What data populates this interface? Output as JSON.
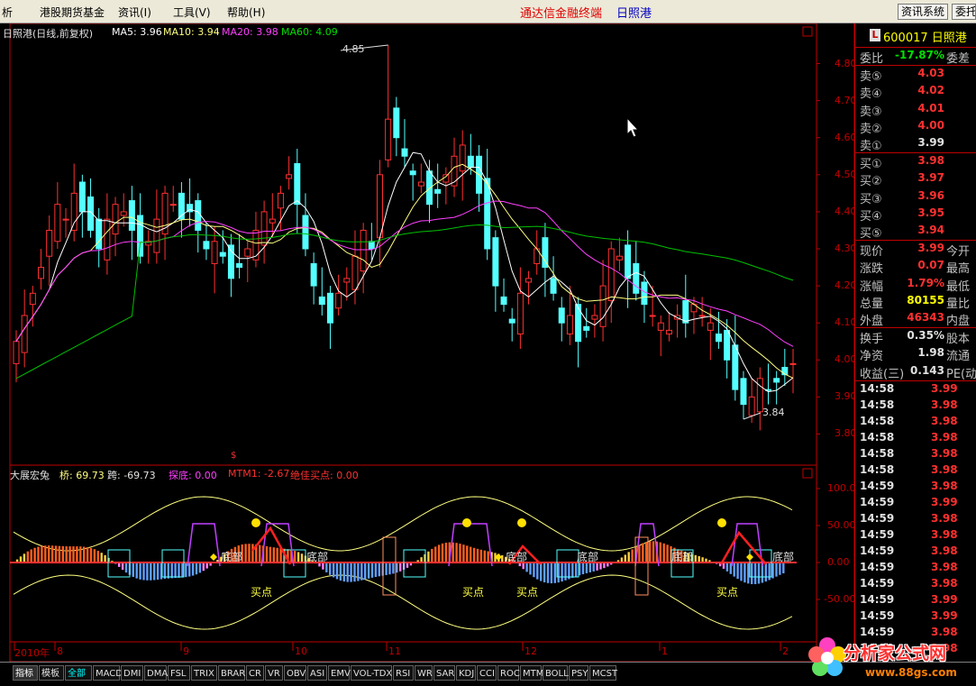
{
  "menu": {
    "items": [
      "析",
      "港股期货基金",
      "资讯(I)",
      "工具(V)",
      "帮助(H)"
    ],
    "app_title": "通达信金融终端",
    "stock_name": "日照港",
    "btn_news": "资讯系统",
    "btn_other": "委托"
  },
  "chart_header": {
    "title": "日照港(日线,前复权)",
    "ma5": "MA5: 3.96",
    "ma10": "MA10: 3.94",
    "ma20": "MA20: 3.98",
    "ma60": "MA60: 4.09",
    "high_mark": "4.85",
    "low_mark": "3.84",
    "dollar": "$"
  },
  "indicator_header": {
    "name": "大展宏兔",
    "qiao": "桥: 69.73",
    "kua": "跨: -69.73",
    "tandi": "探底: 0.00",
    "mtm": "MTM1: -2.67",
    "best": "绝佳买点: 0.00"
  },
  "price_axis": [
    "4.80",
    "4.70",
    "4.60",
    "4.50",
    "4.40",
    "4.30",
    "4.20",
    "4.10",
    "4.00",
    "3.90",
    "3.80"
  ],
  "ind_axis": [
    "100.0",
    "50.00",
    "0.00",
    "-50.00"
  ],
  "date_axis": [
    "2010年",
    "8",
    "9",
    "10",
    "11",
    "12",
    "1",
    "2"
  ],
  "annotations": {
    "bottom": "底部",
    "buy": "买点"
  },
  "quote": {
    "code": "600017",
    "name": "日照港",
    "badge": "L",
    "weibi_label": "委比",
    "weibi_value": "-17.87%",
    "weibi_extra": "委差",
    "sells": [
      {
        "label": "卖⑤",
        "price": "4.03"
      },
      {
        "label": "卖④",
        "price": "4.02"
      },
      {
        "label": "卖③",
        "price": "4.01"
      },
      {
        "label": "卖②",
        "price": "4.00"
      },
      {
        "label": "卖①",
        "price": "3.99"
      }
    ],
    "buys": [
      {
        "label": "买①",
        "price": "3.98"
      },
      {
        "label": "买②",
        "price": "3.97"
      },
      {
        "label": "买③",
        "price": "3.96"
      },
      {
        "label": "买④",
        "price": "3.95"
      },
      {
        "label": "买⑤",
        "price": "3.94"
      }
    ],
    "stats": [
      {
        "label": "现价",
        "value": "3.99",
        "extra": "今开",
        "color": "#ff3030"
      },
      {
        "label": "涨跌",
        "value": "0.07",
        "extra": "最高",
        "color": "#ff3030"
      },
      {
        "label": "涨幅",
        "value": "1.79%",
        "extra": "最低",
        "color": "#ff3030"
      },
      {
        "label": "总量",
        "value": "80155",
        "extra": "量比",
        "color": "#ffff00"
      },
      {
        "label": "外盘",
        "value": "46343",
        "extra": "内盘",
        "color": "#ff3030"
      }
    ],
    "stats2": [
      {
        "label": "换手",
        "value": "0.35%",
        "extra": "股本",
        "color": "#e0e0e0"
      },
      {
        "label": "净资",
        "value": "1.98",
        "extra": "流通",
        "color": "#e0e0e0"
      },
      {
        "label": "收益(三)",
        "value": "0.143",
        "extra": "PE(动",
        "color": "#e0e0e0"
      }
    ],
    "ticks": [
      {
        "time": "14:58",
        "price": "3.99"
      },
      {
        "time": "14:58",
        "price": "3.98"
      },
      {
        "time": "14:58",
        "price": "3.98"
      },
      {
        "time": "14:58",
        "price": "3.98"
      },
      {
        "time": "14:58",
        "price": "3.98"
      },
      {
        "time": "14:58",
        "price": "3.98"
      },
      {
        "time": "14:59",
        "price": "3.98"
      },
      {
        "time": "14:59",
        "price": "3.99"
      },
      {
        "time": "14:59",
        "price": "3.98"
      },
      {
        "time": "14:59",
        "price": "3.98"
      },
      {
        "time": "14:59",
        "price": "3.98"
      },
      {
        "time": "14:59",
        "price": "3.98"
      },
      {
        "time": "14:59",
        "price": "3.98"
      },
      {
        "time": "14:59",
        "price": "3.99"
      },
      {
        "time": "14:59",
        "price": "3.99"
      },
      {
        "time": "14:59",
        "price": "3.98"
      },
      {
        "time": "14:59",
        "price": "3.98"
      }
    ]
  },
  "tabs": [
    "指标",
    "模板",
    "全部",
    "MACD",
    "DMI",
    "DMA",
    "FSL",
    "TRIX",
    "BRAR",
    "CR",
    "VR",
    "OBV",
    "ASI",
    "EMV",
    "VOL-TDX",
    "RSI",
    "WR",
    "SAR",
    "KDJ",
    "CCI",
    "ROC",
    "MTM",
    "BOLL",
    "PSY",
    "MCST"
  ],
  "logo": {
    "line1": "分析家公式网",
    "line2": "www.88gs.com"
  },
  "colors": {
    "up": "#ff3030",
    "down": "#54ffff",
    "ma5": "#ffffff",
    "ma10": "#ffff80",
    "ma20": "#ff40ff",
    "ma60": "#00c000",
    "axis": "#c00000"
  },
  "chart_data": {
    "type": "candlestick",
    "title": "日照港(日线,前复权)",
    "ylim": [
      3.75,
      4.85
    ],
    "high": 4.85,
    "low": 3.84,
    "closes": [
      4.05,
      4.12,
      4.18,
      4.25,
      4.35,
      4.42,
      4.38,
      4.45,
      4.4,
      4.35,
      4.3,
      4.38,
      4.42,
      4.4,
      4.35,
      4.28,
      4.32,
      4.38,
      4.45,
      4.42,
      4.38,
      4.4,
      4.35,
      4.3,
      4.32,
      4.28,
      4.22,
      4.25,
      4.3,
      4.35,
      4.4,
      4.38,
      4.45,
      4.5,
      4.42,
      4.3,
      4.2,
      4.15,
      4.1,
      4.18,
      4.22,
      4.28,
      4.35,
      4.3,
      4.5,
      4.65,
      4.6,
      4.55,
      4.5,
      4.48,
      4.42,
      4.45,
      4.5,
      4.55,
      4.58,
      4.52,
      4.45,
      4.3,
      4.2,
      4.15,
      4.1,
      4.18,
      4.22,
      4.3,
      4.25,
      4.18,
      4.1,
      4.12,
      4.05,
      4.08,
      4.12,
      4.2,
      4.3,
      4.28,
      4.22,
      4.18,
      4.15,
      4.12,
      4.1,
      4.08,
      4.12,
      4.1,
      4.15,
      4.12,
      4.1,
      4.05,
      4.0,
      3.92,
      3.88,
      3.9,
      3.95,
      3.92,
      3.94,
      3.96,
      3.99
    ]
  }
}
